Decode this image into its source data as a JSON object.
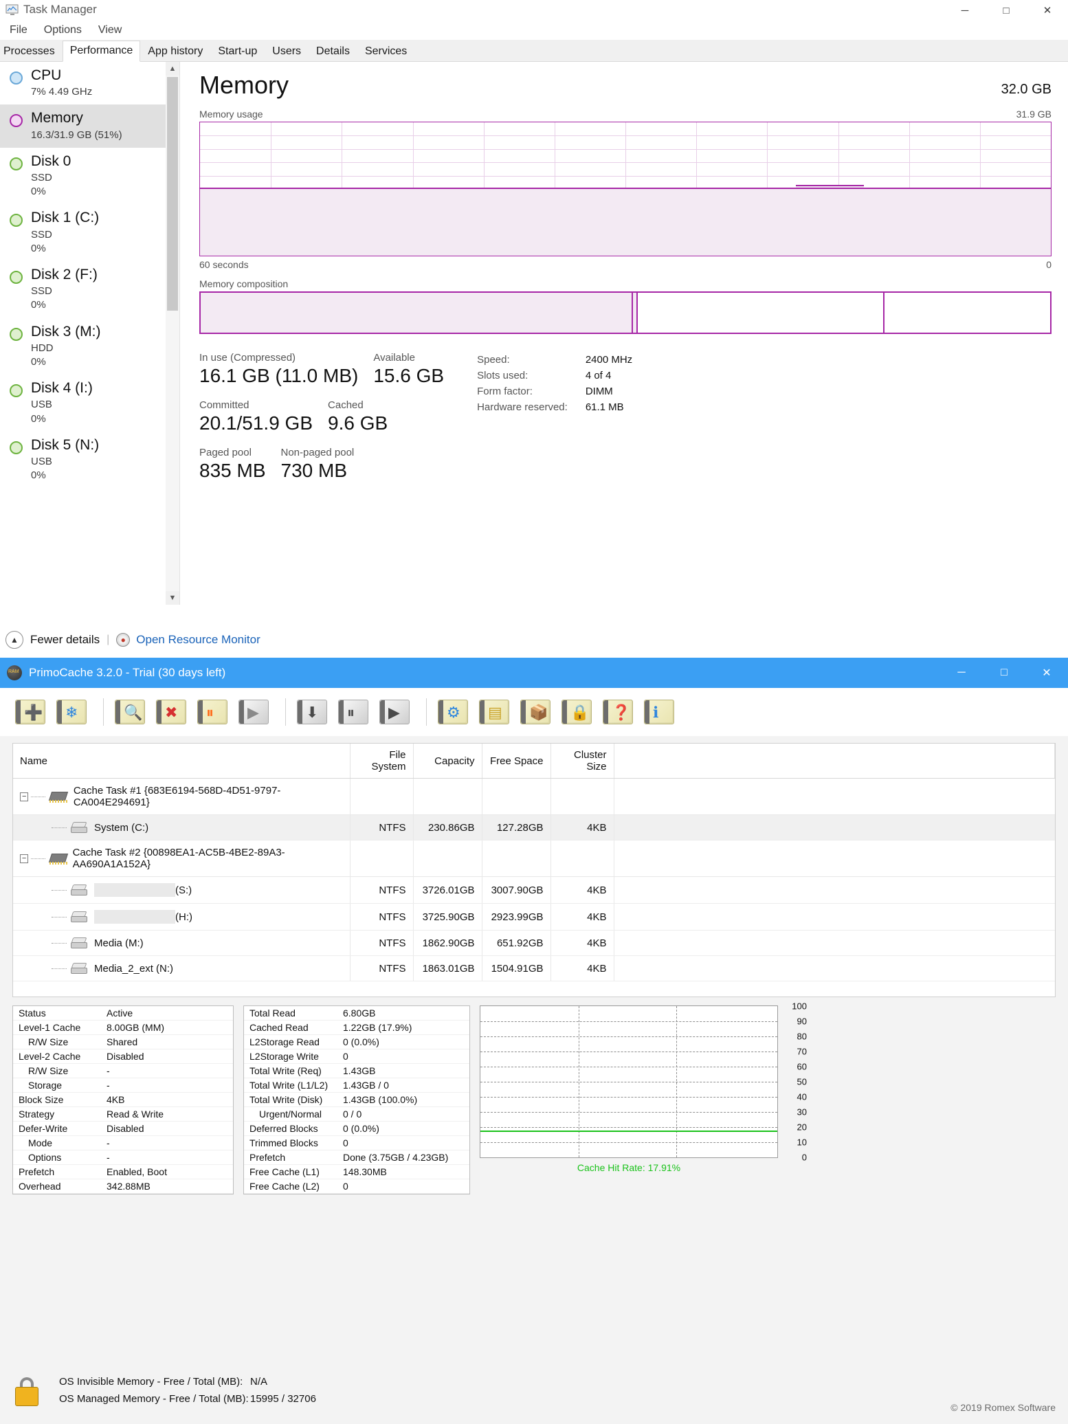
{
  "taskmanager": {
    "window_title": "Task Manager",
    "icon": "task-manager-icon",
    "window_buttons": {
      "minimize": "─",
      "maximize": "□",
      "close": "✕"
    },
    "menu": [
      "File",
      "Options",
      "View"
    ],
    "tabs": [
      {
        "label": "Processes",
        "active": false
      },
      {
        "label": "Performance",
        "active": true
      },
      {
        "label": "App history",
        "active": false
      },
      {
        "label": "Start-up",
        "active": false
      },
      {
        "label": "Users",
        "active": false
      },
      {
        "label": "Details",
        "active": false
      },
      {
        "label": "Services",
        "active": false
      }
    ],
    "sidebar": [
      {
        "name": "CPU",
        "sub1": "7%  4.49 GHz",
        "sub2": "",
        "color": "#cfe6f7",
        "border": "#6aa8d8",
        "selected": false
      },
      {
        "name": "Memory",
        "sub1": "16.3/31.9 GB (51%)",
        "sub2": "",
        "color": "#f3d9f3",
        "border": "#a626a6",
        "selected": true
      },
      {
        "name": "Disk 0",
        "sub1": "SSD",
        "sub2": "0%",
        "color": "#dff0cf",
        "border": "#6db33f",
        "selected": false
      },
      {
        "name": "Disk 1 (C:)",
        "sub1": "SSD",
        "sub2": "0%",
        "color": "#dff0cf",
        "border": "#6db33f",
        "selected": false
      },
      {
        "name": "Disk 2 (F:)",
        "sub1": "SSD",
        "sub2": "0%",
        "color": "#dff0cf",
        "border": "#6db33f",
        "selected": false
      },
      {
        "name": "Disk 3 (M:)",
        "sub1": "HDD",
        "sub2": "0%",
        "color": "#dff0cf",
        "border": "#6db33f",
        "selected": false
      },
      {
        "name": "Disk 4 (I:)",
        "sub1": "USB",
        "sub2": "0%",
        "color": "#dff0cf",
        "border": "#6db33f",
        "selected": false
      },
      {
        "name": "Disk 5 (N:)",
        "sub1": "USB",
        "sub2": "0%",
        "color": "#dff0cf",
        "border": "#6db33f",
        "selected": false
      }
    ],
    "memory": {
      "title": "Memory",
      "total": "32.0 GB",
      "graph_label": "Memory usage",
      "graph_max": "31.9 GB",
      "axis_left": "60 seconds",
      "axis_right": "0",
      "composition_label": "Memory composition",
      "usage_percent": 51,
      "composition": [
        {
          "name": "in-use",
          "percent": 51
        },
        {
          "name": "modified",
          "percent": 0.4
        },
        {
          "name": "standby",
          "percent": 29
        },
        {
          "name": "free",
          "percent": 19.6
        }
      ],
      "stats": [
        {
          "label": "In use (Compressed)",
          "value": "16.1 GB (11.0 MB)"
        },
        {
          "label": "Available",
          "value": "15.6 GB"
        },
        {
          "label": "Committed",
          "value": "20.1/51.9 GB"
        },
        {
          "label": "Cached",
          "value": "9.6 GB"
        },
        {
          "label": "Paged pool",
          "value": "835 MB"
        },
        {
          "label": "Non-paged pool",
          "value": "730 MB"
        }
      ],
      "specs": [
        {
          "key": "Speed:",
          "value": "2400 MHz"
        },
        {
          "key": "Slots used:",
          "value": "4 of 4"
        },
        {
          "key": "Form factor:",
          "value": "DIMM"
        },
        {
          "key": "Hardware reserved:",
          "value": "61.1 MB"
        }
      ]
    },
    "footer": {
      "fewer_details": "Fewer details",
      "resource_monitor": "Open Resource Monitor"
    }
  },
  "primocache": {
    "window_title": "PrimoCache 3.2.0 - Trial (30 days left)",
    "window_buttons": {
      "minimize": "─",
      "maximize": "□",
      "close": "✕"
    },
    "toolbar": [
      {
        "name": "create-cache-task-button",
        "glyph": "➕",
        "color": "#2eb82e",
        "style": "fold"
      },
      {
        "name": "create-ramdisk-button",
        "glyph": "❄",
        "color": "#2e86de",
        "style": "fold"
      },
      {
        "name": "sep1",
        "glyph": "",
        "color": "",
        "style": "sep"
      },
      {
        "name": "view-task-button",
        "glyph": "🔍",
        "color": "#7a7a7a",
        "style": "fold"
      },
      {
        "name": "delete-task-button",
        "glyph": "✖",
        "color": "#d63031",
        "style": "fold"
      },
      {
        "name": "pause-task-button",
        "glyph": "⏸",
        "color": "#ff6b1a",
        "style": "fold"
      },
      {
        "name": "start-task-button",
        "glyph": "▶",
        "color": "#8a8a8a",
        "style": "gray"
      },
      {
        "name": "sep2",
        "glyph": "",
        "color": "",
        "style": "sep"
      },
      {
        "name": "flush-now-button",
        "glyph": "⬇",
        "color": "#4a4a4a",
        "style": "gray"
      },
      {
        "name": "pause-defer-write-button",
        "glyph": "⏸",
        "color": "#4a4a4a",
        "style": "gray"
      },
      {
        "name": "resume-defer-write-button",
        "glyph": "▶",
        "color": "#4a4a4a",
        "style": "gray"
      },
      {
        "name": "sep3",
        "glyph": "",
        "color": "",
        "style": "sep"
      },
      {
        "name": "task-settings-button",
        "glyph": "⚙",
        "color": "#2e86de",
        "style": "fold"
      },
      {
        "name": "memory-settings-button",
        "glyph": "▤",
        "color": "#c9a227",
        "style": "fold"
      },
      {
        "name": "options-button",
        "glyph": "📦",
        "color": "#c98a27",
        "style": "fold"
      },
      {
        "name": "license-button",
        "glyph": "🔒",
        "color": "#888888",
        "style": "fold"
      },
      {
        "name": "help-button",
        "glyph": "❓",
        "color": "#d63031",
        "style": "fold"
      },
      {
        "name": "about-button",
        "glyph": "ℹ",
        "color": "#2e86de",
        "style": "fold"
      }
    ],
    "table": {
      "columns": [
        "Name",
        "File System",
        "Capacity",
        "Free Space",
        "Cluster Size"
      ],
      "rows": [
        {
          "type": "task",
          "indent": 0,
          "name": "Cache Task #1 {683E6194-568D-4D51-9797-CA004E294691}",
          "fs": "",
          "capacity": "",
          "free": "",
          "cluster": "",
          "selected": false,
          "redacted": false
        },
        {
          "type": "volume",
          "indent": 1,
          "name": "System (C:)",
          "fs": "NTFS",
          "capacity": "230.86GB",
          "free": "127.28GB",
          "cluster": "4KB",
          "selected": true,
          "redacted": false
        },
        {
          "type": "task",
          "indent": 0,
          "name": "Cache Task #2 {00898EA1-AC5B-4BE2-89A3-AA690A1A152A}",
          "fs": "",
          "capacity": "",
          "free": "",
          "cluster": "",
          "selected": false,
          "redacted": false
        },
        {
          "type": "volume",
          "indent": 1,
          "name": "(S:)",
          "fs": "NTFS",
          "capacity": "3726.01GB",
          "free": "3007.90GB",
          "cluster": "4KB",
          "selected": false,
          "redacted": true
        },
        {
          "type": "volume",
          "indent": 1,
          "name": "(H:)",
          "fs": "NTFS",
          "capacity": "3725.90GB",
          "free": "2923.99GB",
          "cluster": "4KB",
          "selected": false,
          "redacted": true
        },
        {
          "type": "volume",
          "indent": 1,
          "name": "Media (M:)",
          "fs": "NTFS",
          "capacity": "1862.90GB",
          "free": "651.92GB",
          "cluster": "4KB",
          "selected": false,
          "redacted": false
        },
        {
          "type": "volume",
          "indent": 1,
          "name": "Media_2_ext (N:)",
          "fs": "NTFS",
          "capacity": "1863.01GB",
          "free": "1504.91GB",
          "cluster": "4KB",
          "selected": false,
          "redacted": false
        }
      ]
    },
    "status_panel": [
      {
        "key": "Status",
        "value": "Active",
        "indent": false
      },
      {
        "key": "Level-1 Cache",
        "value": "8.00GB (MM)",
        "indent": false
      },
      {
        "key": "R/W Size",
        "value": "Shared",
        "indent": true
      },
      {
        "key": "Level-2 Cache",
        "value": "Disabled",
        "indent": false
      },
      {
        "key": "R/W Size",
        "value": "-",
        "indent": true
      },
      {
        "key": "Storage",
        "value": "-",
        "indent": true
      },
      {
        "key": "Block Size",
        "value": "4KB",
        "indent": false
      },
      {
        "key": "Strategy",
        "value": "Read & Write",
        "indent": false
      },
      {
        "key": "Defer-Write",
        "value": "Disabled",
        "indent": false
      },
      {
        "key": "Mode",
        "value": "-",
        "indent": true
      },
      {
        "key": "Options",
        "value": "-",
        "indent": true
      },
      {
        "key": "Prefetch",
        "value": "Enabled, Boot",
        "indent": false
      },
      {
        "key": "Overhead",
        "value": "342.88MB",
        "indent": false
      }
    ],
    "stats_panel": [
      {
        "key": "Total Read",
        "value": "6.80GB",
        "indent": false
      },
      {
        "key": "Cached Read",
        "value": "1.22GB (17.9%)",
        "indent": false
      },
      {
        "key": "L2Storage Read",
        "value": "0 (0.0%)",
        "indent": false
      },
      {
        "key": "L2Storage Write",
        "value": "0",
        "indent": false
      },
      {
        "key": "Total Write (Req)",
        "value": "1.43GB",
        "indent": false
      },
      {
        "key": "Total Write (L1/L2)",
        "value": "1.43GB / 0",
        "indent": false
      },
      {
        "key": "Total Write (Disk)",
        "value": "1.43GB (100.0%)",
        "indent": false
      },
      {
        "key": "Urgent/Normal",
        "value": "0 / 0",
        "indent": true
      },
      {
        "key": "Deferred Blocks",
        "value": "0 (0.0%)",
        "indent": false
      },
      {
        "key": "Trimmed Blocks",
        "value": "0",
        "indent": false
      },
      {
        "key": "Prefetch",
        "value": "Done (3.75GB / 4.23GB)",
        "indent": false
      },
      {
        "key": "Free Cache (L1)",
        "value": "148.30MB",
        "indent": false
      },
      {
        "key": "Free Cache (L2)",
        "value": "0",
        "indent": false
      }
    ],
    "footer": {
      "os_invisible_label": "OS Invisible Memory - Free / Total (MB):",
      "os_invisible_value": "N/A",
      "os_managed_label": "OS Managed Memory - Free / Total (MB):",
      "os_managed_value": "15995 / 32706",
      "copyright": "© 2019 Romex Software"
    }
  },
  "chart_data": {
    "type": "line",
    "title": "Cache Hit Rate: 17.91%",
    "series": [
      {
        "name": "Cache Hit Rate",
        "values": [
          17.91,
          17.91,
          17.91,
          17.91,
          17.91
        ],
        "color": "#19c219"
      }
    ],
    "yticks": [
      100,
      90,
      80,
      70,
      60,
      50,
      40,
      30,
      20,
      10,
      0
    ],
    "ylim": [
      0,
      100
    ],
    "ylabel": "",
    "xlabel": "",
    "grid": true,
    "legend": "bottom"
  }
}
